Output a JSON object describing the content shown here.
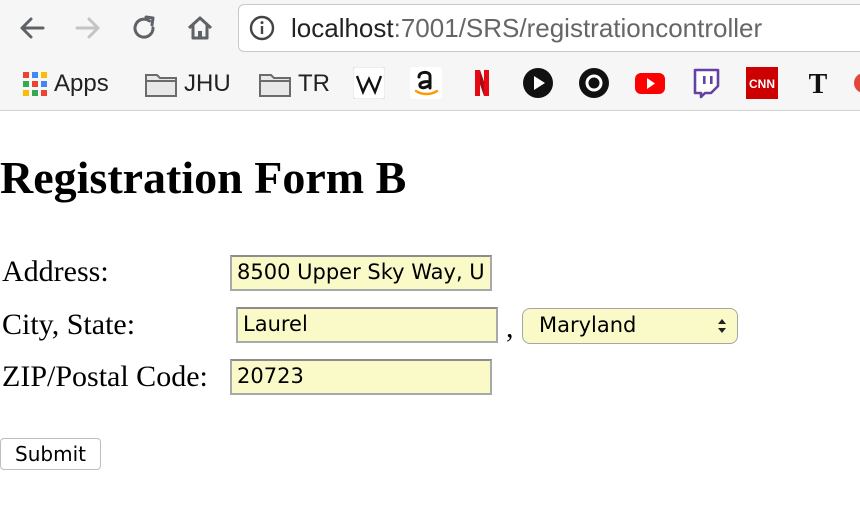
{
  "browser": {
    "url_host": "localhost",
    "url_path": ":7001/SRS/registrationcontroller"
  },
  "bookmarks": {
    "apps": "Apps",
    "folders": [
      "JHU",
      "TR"
    ],
    "icons": [
      "wikipedia-icon",
      "amazon-icon",
      "netflix-icon",
      "play-icon",
      "circle-icon",
      "youtube-icon",
      "twitch-icon",
      "cnn-icon",
      "nytimes-icon"
    ]
  },
  "page": {
    "title": "Registration Form B",
    "address_label": "Address:",
    "address_value": "8500 Upper Sky Way, U",
    "city_state_label": "City, State:",
    "city_value": "Laurel",
    "separator": ",",
    "state_value": "Maryland",
    "zip_label": "ZIP/Postal Code:",
    "zip_value": "20723",
    "submit_label": "Submit"
  },
  "colors": {
    "field_background": "#fafac8",
    "netflix": "#e50914",
    "youtube": "#ff0000",
    "twitch": "#6441a5",
    "cnn": "#cc0000"
  }
}
